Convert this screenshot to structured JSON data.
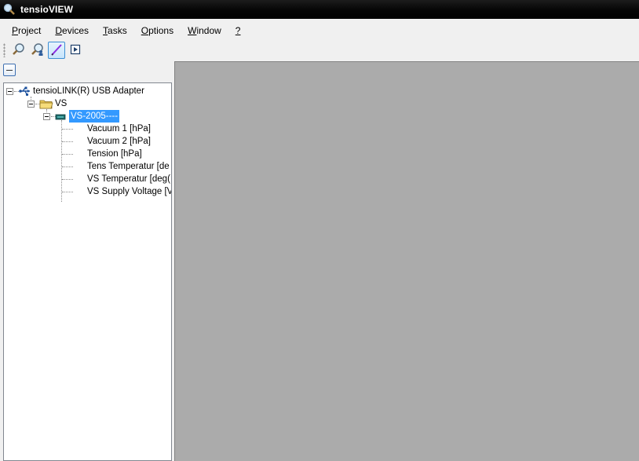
{
  "window": {
    "title": "tensioVIEW"
  },
  "menu": [
    {
      "accel": "P",
      "rest": "roject"
    },
    {
      "accel": "D",
      "rest": "evices"
    },
    {
      "accel": "T",
      "rest": "asks"
    },
    {
      "accel": "O",
      "rest": "ptions"
    },
    {
      "accel": "W",
      "rest": "indow"
    },
    {
      "accel": "?",
      "rest": ""
    }
  ],
  "toolbar": {
    "buttons": [
      {
        "icon": "zoom-icon",
        "active": false
      },
      {
        "icon": "zoom-user-icon",
        "active": false
      },
      {
        "icon": "pen-icon",
        "active": true
      },
      {
        "icon": "export-icon",
        "active": false
      }
    ]
  },
  "tree": {
    "adapter": "tensioLINK(R) USB Adapter",
    "group": "VS",
    "device": "VS-2005----",
    "channels": [
      "Vacuum 1 [hPa]",
      "Vacuum 2 [hPa]",
      "Tension [hPa]",
      "Tens Temperatur [de",
      "VS Temperatur [deg(",
      "VS Supply Voltage [V"
    ]
  }
}
